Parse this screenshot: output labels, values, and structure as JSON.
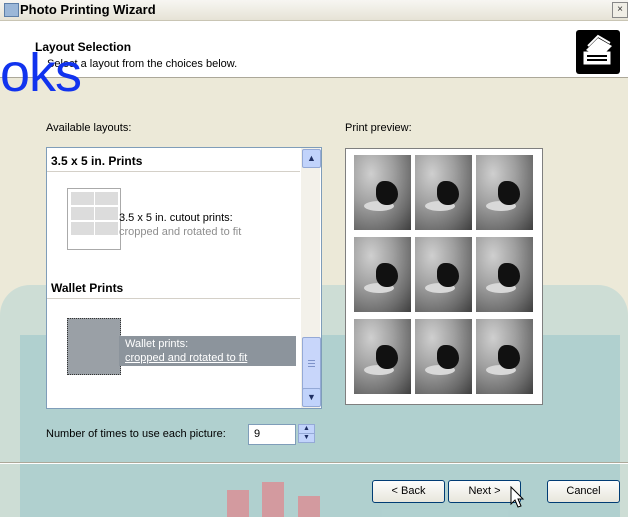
{
  "window": {
    "title": "Photo Printing Wizard",
    "close_glyph": "×"
  },
  "header": {
    "title": "Layout Selection",
    "subtitle": "Select a layout from the choices below.",
    "icon": "printer-stack-icon"
  },
  "watermark": "oks",
  "layouts": {
    "label": "Available layouts:",
    "groups": [
      {
        "heading": "3.5 x 5 in. Prints",
        "item": {
          "name": "3.5 x 5 in. cutout prints:",
          "desc": "cropped and rotated to fit"
        }
      },
      {
        "heading": "Wallet Prints",
        "item": {
          "name": "Wallet prints:",
          "desc": "cropped and rotated to fit",
          "selected": true
        }
      }
    ]
  },
  "preview": {
    "label": "Print preview:"
  },
  "copies": {
    "label": "Number of times to use each picture:",
    "value": "9"
  },
  "buttons": {
    "back": "< Back",
    "next": "Next >",
    "cancel": "Cancel"
  },
  "colors": {
    "selection": "#8c949c",
    "border": "#7f9db9",
    "accent": "#003c74"
  }
}
